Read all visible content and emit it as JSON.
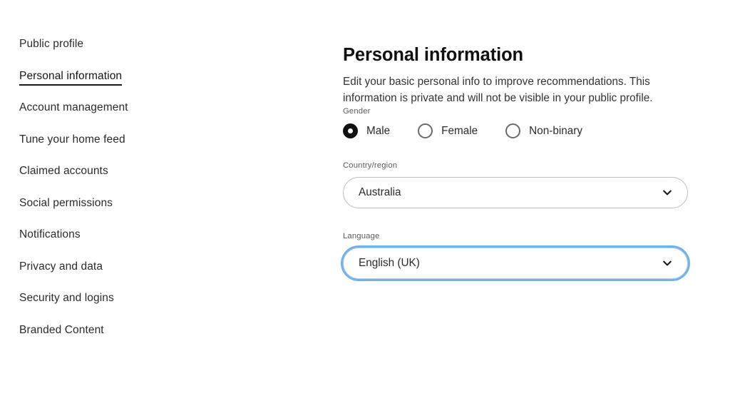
{
  "sidebar": {
    "items": [
      {
        "label": "Public profile",
        "active": false
      },
      {
        "label": "Personal information",
        "active": true
      },
      {
        "label": "Account management",
        "active": false
      },
      {
        "label": "Tune your home feed",
        "active": false
      },
      {
        "label": "Claimed accounts",
        "active": false
      },
      {
        "label": "Social permissions",
        "active": false
      },
      {
        "label": "Notifications",
        "active": false
      },
      {
        "label": "Privacy and data",
        "active": false
      },
      {
        "label": "Security and logins",
        "active": false
      },
      {
        "label": "Branded Content",
        "active": false
      }
    ]
  },
  "main": {
    "title": "Personal information",
    "description": "Edit your basic personal info to improve recommendations. This information is private and will not be visible in your public profile.",
    "gender": {
      "label": "Gender",
      "options": [
        {
          "label": "Male",
          "selected": true
        },
        {
          "label": "Female",
          "selected": false
        },
        {
          "label": "Non-binary",
          "selected": false
        }
      ]
    },
    "country": {
      "label": "Country/region",
      "value": "Australia",
      "icon": "chevron-down-icon"
    },
    "language": {
      "label": "Language",
      "value": "English (UK)",
      "icon": "chevron-down-icon",
      "focused": true,
      "focus_ring_color": "#6cb4ef"
    }
  },
  "colors": {
    "background": "#ffffff",
    "text": "#2b2b2b",
    "label": "#5b5b5b",
    "border": "#bdbdbd",
    "accent_focus": "#6cb4ef",
    "radio_selected": "#111111"
  }
}
